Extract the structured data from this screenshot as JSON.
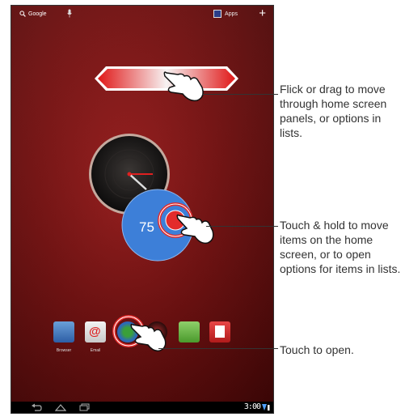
{
  "topbar": {
    "search_label": "Google",
    "apps_label": "Apps",
    "add_symbol": "+"
  },
  "weather": {
    "temp": "75"
  },
  "dock": {
    "apps": [
      {
        "label": "Browser"
      },
      {
        "label": "Email"
      },
      {
        "label": ""
      },
      {
        "label": ""
      },
      {
        "label": ""
      },
      {
        "label": ""
      }
    ]
  },
  "status": {
    "time": "3:00"
  },
  "callouts": {
    "flick": "Flick or drag to move through home screen panels, or options in lists.",
    "hold": "Touch & hold to move items on the home screen, or to open options for items in lists.",
    "touch": "Touch to open."
  },
  "colors": {
    "wallpaper": "#8b1414",
    "callout_line": "#333333",
    "touch_ring": "#e32b2b"
  }
}
